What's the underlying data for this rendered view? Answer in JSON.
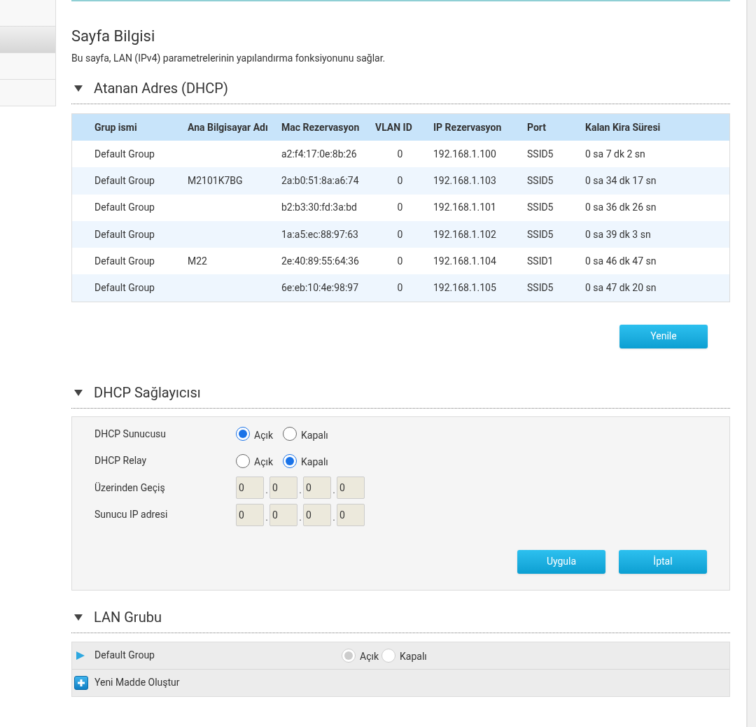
{
  "sidebar": {
    "items": [
      {
        "selected": false
      },
      {
        "selected": true
      },
      {
        "selected": false
      },
      {
        "selected": false
      }
    ]
  },
  "page_info": {
    "title": "Sayfa Bilgisi",
    "description": "Bu sayfa, LAN (IPv4) parametrelerinin yapılandırma fonksiyonunu sağlar."
  },
  "assigned_addresses": {
    "title": "Atanan Adres (DHCP)",
    "expanded": true,
    "table": {
      "columns": [
        "Grup ismi",
        "Ana Bilgisayar Adı",
        "Mac Rezervasyon",
        "VLAN ID",
        "IP Rezervasyon",
        "Port",
        "Kalan Kira Süresi"
      ],
      "rows": [
        [
          "Default Group",
          "",
          "a2:f4:17:0e:8b:26",
          "0",
          "192.168.1.100",
          "SSID5",
          "0 sa 7 dk 2 sn"
        ],
        [
          "Default Group",
          "M2101K7BG",
          "2a:b0:51:8a:a6:74",
          "0",
          "192.168.1.103",
          "SSID5",
          "0 sa 34 dk 17 sn"
        ],
        [
          "Default Group",
          "",
          "b2:b3:30:fd:3a:bd",
          "0",
          "192.168.1.101",
          "SSID5",
          "0 sa 36 dk 26 sn"
        ],
        [
          "Default Group",
          "",
          "1a:a5:ec:88:97:63",
          "0",
          "192.168.1.102",
          "SSID5",
          "0 sa 39 dk 3 sn"
        ],
        [
          "Default Group",
          "M22",
          "2e:40:89:55:64:36",
          "0",
          "192.168.1.104",
          "SSID1",
          "0 sa 46 dk 47 sn"
        ],
        [
          "Default Group",
          "",
          "6e:eb:10:4e:98:97",
          "0",
          "192.168.1.105",
          "SSID5",
          "0 sa 47 dk 20 sn"
        ]
      ]
    },
    "refresh_button": "Yenile"
  },
  "dhcp_provider": {
    "title": "DHCP Sağlayıcısı",
    "expanded": true,
    "rows": [
      {
        "kind": "radio",
        "label": "DHCP Sunucusu",
        "options": [
          {
            "label": "Açık",
            "selected": true
          },
          {
            "label": "Kapalı",
            "selected": false
          }
        ]
      },
      {
        "kind": "radio",
        "label": "DHCP Relay",
        "options": [
          {
            "label": "Açık",
            "selected": false
          },
          {
            "label": "Kapalı",
            "selected": true
          }
        ]
      },
      {
        "kind": "ip",
        "label": "Üzerinden Geçiş",
        "octets": [
          "0",
          "0",
          "0",
          "0"
        ],
        "separator": "."
      },
      {
        "kind": "ip",
        "label": "Sunucu IP adresi",
        "octets": [
          "0",
          "0",
          "0",
          "0"
        ],
        "separator": "."
      }
    ],
    "buttons": [
      "Uygula",
      "İptal"
    ]
  },
  "lan_group": {
    "title": "LAN Grubu",
    "expanded": true,
    "groups": [
      {
        "name": "Default Group",
        "expanded": false,
        "options": [
          {
            "label": "Açık",
            "selected": true,
            "disabled": true
          },
          {
            "label": "Kapalı",
            "selected": false,
            "disabled": true
          }
        ]
      }
    ],
    "add_item": "Yeni Madde Oluştur"
  }
}
